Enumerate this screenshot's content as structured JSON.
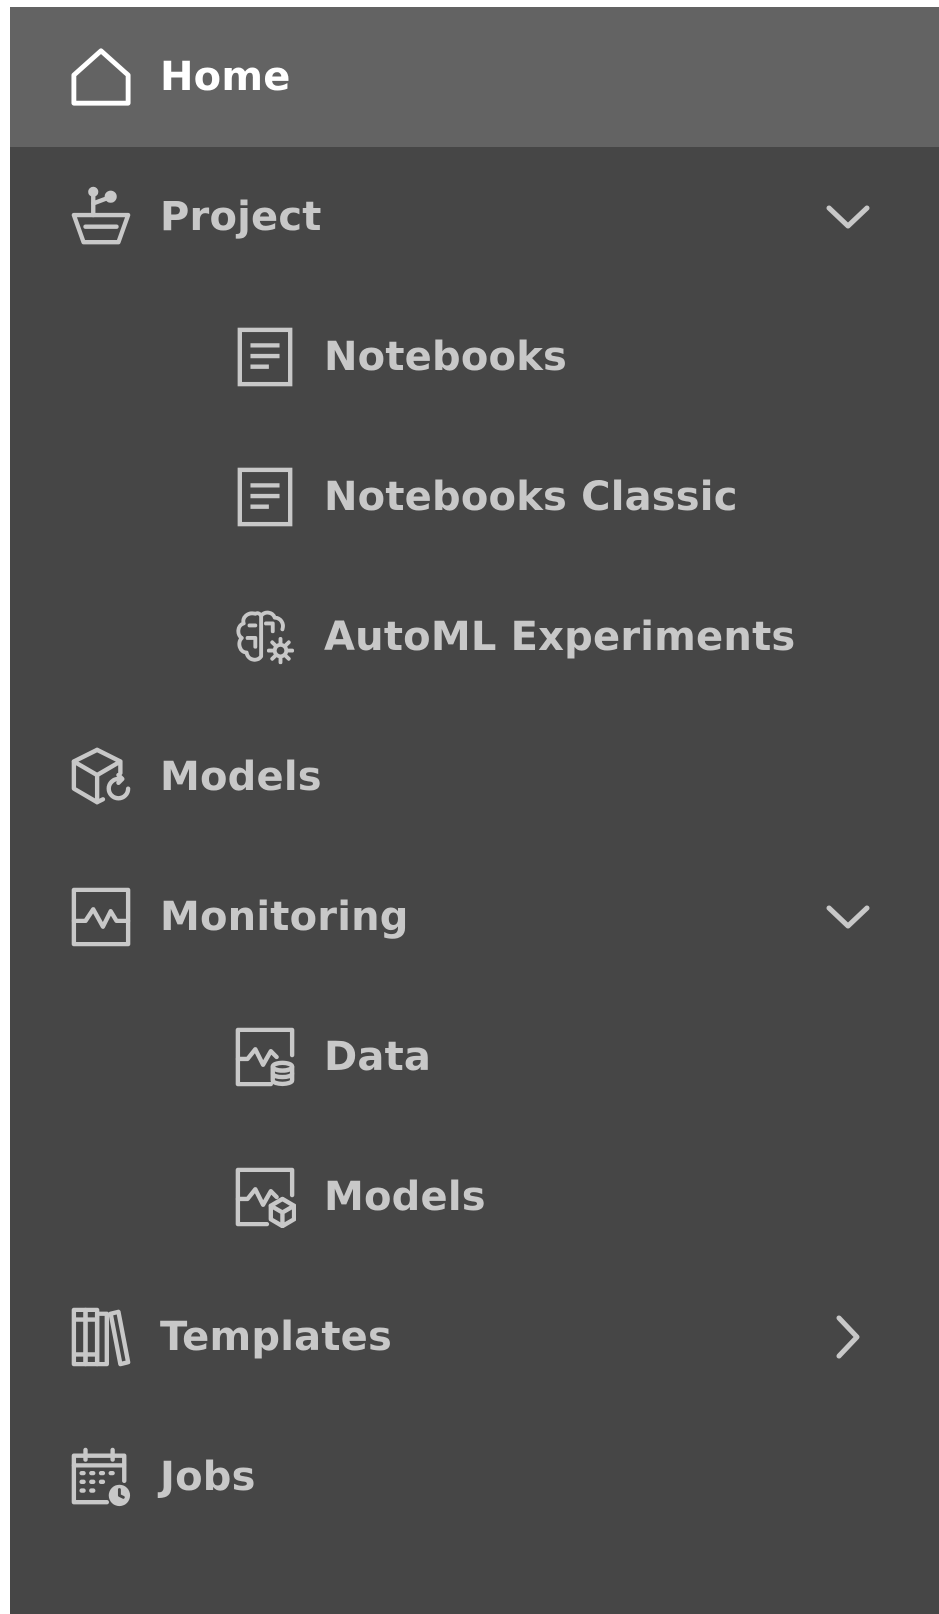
{
  "nav": {
    "home": {
      "label": "Home",
      "icon": "home-icon"
    },
    "project": {
      "label": "Project",
      "icon": "project-icon",
      "expanded": true,
      "children": {
        "notebooks": {
          "label": "Notebooks",
          "icon": "notebook-icon"
        },
        "notebooks_classic": {
          "label": "Notebooks Classic",
          "icon": "notebook-icon"
        },
        "automl": {
          "label": "AutoML Experiments",
          "icon": "brain-gear-icon"
        }
      }
    },
    "models": {
      "label": "Models",
      "icon": "model-cube-icon"
    },
    "monitoring": {
      "label": "Monitoring",
      "icon": "monitoring-chart-icon",
      "expanded": true,
      "children": {
        "data": {
          "label": "Data",
          "icon": "monitoring-data-icon"
        },
        "models": {
          "label": "Models",
          "icon": "monitoring-models-icon"
        }
      }
    },
    "templates": {
      "label": "Templates",
      "icon": "templates-books-icon",
      "expanded": false
    },
    "jobs": {
      "label": "Jobs",
      "icon": "jobs-calendar-icon"
    }
  },
  "colors": {
    "sidebar_bg": "#464646",
    "active_bg": "#636363",
    "text": "#c8c8c8",
    "active_text": "#ffffff"
  }
}
